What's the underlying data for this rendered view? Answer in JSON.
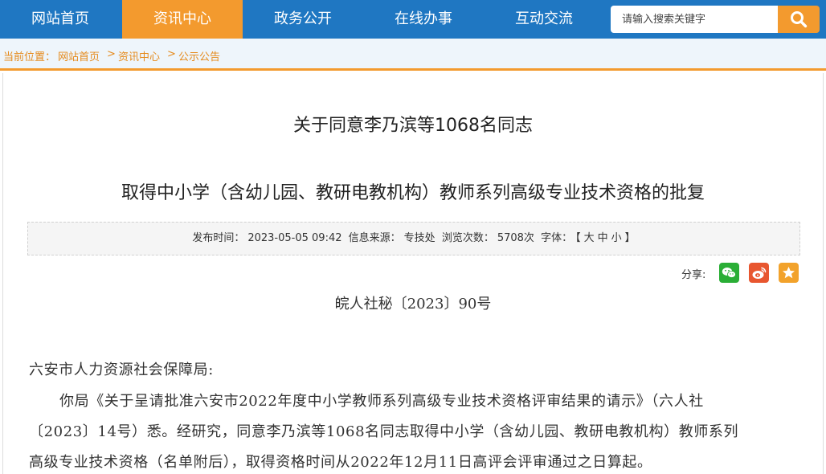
{
  "nav": {
    "items": [
      "网站首页",
      "资讯中心",
      "政务公开",
      "在线办事",
      "互动交流"
    ],
    "active_index": 1
  },
  "search": {
    "placeholder": "请输入搜索关键字",
    "icon": "search-icon"
  },
  "breadcrumb": {
    "prefix": "当前位置：",
    "items": [
      "网站首页",
      "资讯中心",
      "公示公告"
    ],
    "separator": ">"
  },
  "article": {
    "title_line1": "关于同意李乃滨等1068名同志",
    "title_line2": "取得中小学（含幼儿园、教研电教机构）教师系列高级专业技术资格的批复",
    "meta": {
      "publish_label": "发布时间：",
      "publish_time": "2023-05-05 09:42",
      "source_label": "信息来源：",
      "source": "专技处",
      "views_label": "浏览次数：",
      "views": "5708次",
      "font_label": "字体：",
      "font_open": "【",
      "font_large": "大",
      "font_medium": "中",
      "font_small": "小",
      "font_close": "】"
    },
    "share_label": "分享:",
    "share_icons": [
      "wechat-icon",
      "weibo-icon",
      "favorite-icon"
    ],
    "doc_number": "皖人社秘〔2023〕90号",
    "addressee": "六安市人力资源社会保障局:",
    "body_lines": [
      "你局《关于呈请批准六安市2022年度中小学教师系列高级专业技术资格评审结果的请示》（六人社",
      "〔2023〕14号）悉。经研究，同意李乃滨等1068名同志取得中小学（含幼儿园、教研电教机构）教师系列",
      "高级专业技术资格（名单附后），取得资格时间从2022年12月11日高评会评审通过之日算起。"
    ]
  },
  "colors": {
    "nav_bg": "#1f77c2",
    "accent": "#f39a2e",
    "crumb_text": "#e58a1c",
    "wechat": "#2aae36",
    "weibo": "#e8562f",
    "favorite": "#f2a22b"
  }
}
